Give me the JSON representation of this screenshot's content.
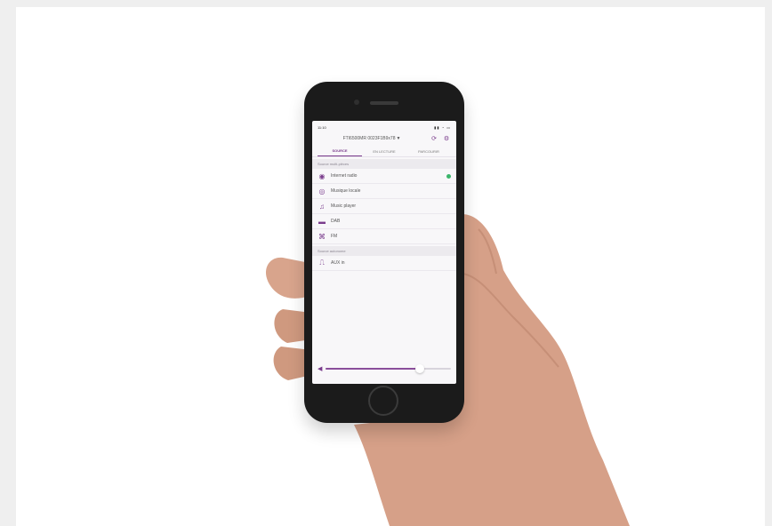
{
  "status_bar": {
    "time": "11:10",
    "indicators": "▮▮ ◔ ▭"
  },
  "device": {
    "name": "FTI6500MR 0023F1B9x78",
    "caret": "▼",
    "sync_icon": "refresh-icon",
    "settings_icon": "gear-icon"
  },
  "tabs": [
    {
      "label": "SOURCE",
      "active": true
    },
    {
      "label": "EN LECTURE",
      "active": false
    },
    {
      "label": "PARCOURIR",
      "active": false
    }
  ],
  "sections": {
    "multi": "Source multi-pièces",
    "autonomous": "Source autonome"
  },
  "sources": [
    {
      "label": "Internet radio",
      "icon": "radio-wave-icon",
      "active": true
    },
    {
      "label": "Musique locale",
      "icon": "local-music-icon",
      "active": false
    },
    {
      "label": "Music player",
      "icon": "music-note-icon",
      "active": false
    },
    {
      "label": "DAB",
      "icon": "dab-icon",
      "active": false
    },
    {
      "label": "FM",
      "icon": "fm-icon",
      "active": false
    }
  ],
  "autonomous_sources": [
    {
      "label": "AUX in",
      "icon": "aux-in-icon"
    }
  ],
  "volume": {
    "level": 0.75,
    "icon": "speaker-icon"
  },
  "colors": {
    "accent": "#7a3c8c",
    "active_dot": "#3bb56b"
  }
}
